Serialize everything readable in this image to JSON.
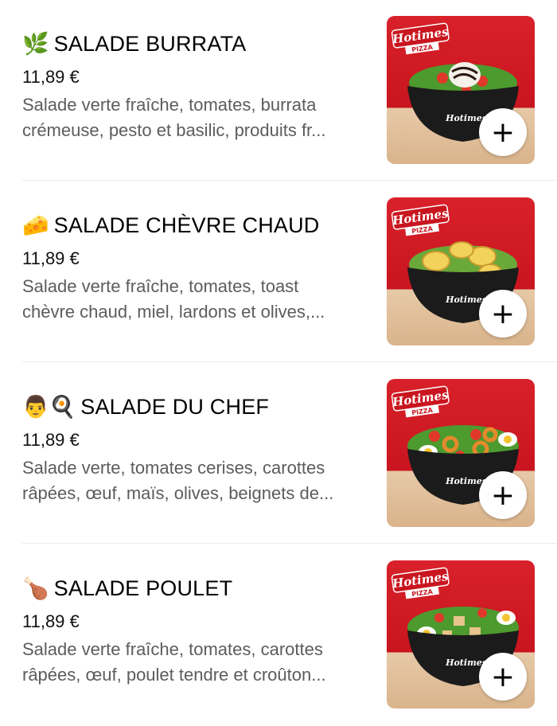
{
  "menu": {
    "items": [
      {
        "emoji": "🌿",
        "title": "SALADE BURRATA",
        "price": "11,89 €",
        "desc_line1": "Salade verte fraîche, tomates, burrata",
        "desc_line2": "crémeuse, pesto et basilic, produits fr...",
        "image_alt": "Salade Burrata bowl"
      },
      {
        "emoji": "🧀",
        "title": "SALADE CHÈVRE CHAUD",
        "price": "11,89 €",
        "desc_line1": "Salade verte fraîche, tomates, toast",
        "desc_line2": "chèvre chaud, miel, lardons et olives,...",
        "image_alt": "Salade Chèvre Chaud bowl"
      },
      {
        "emoji": "👨🍳",
        "title": "SALADE DU CHEF",
        "price": "11,89 €",
        "desc_line1": "Salade verte, tomates cerises, carottes",
        "desc_line2": "râpées, œuf, maïs, olives, beignets de...",
        "image_alt": "Salade du Chef bowl"
      },
      {
        "emoji": "🍗",
        "title": "SALADE POULET",
        "price": "11,89 €",
        "desc_line1": "Salade verte fraîche, tomates, carottes",
        "desc_line2": "râpées, œuf, poulet tendre et croûton...",
        "image_alt": "Salade Poulet bowl"
      }
    ],
    "add_label": "+",
    "brand_logo_text": "Hotimes",
    "brand_logo_sub": "PIZZA"
  },
  "colors": {
    "accent_red": "#d8212a",
    "table_wood": "#dcb58c",
    "bowl": "#1b1b1b",
    "description_gray": "#5c5c5c"
  }
}
